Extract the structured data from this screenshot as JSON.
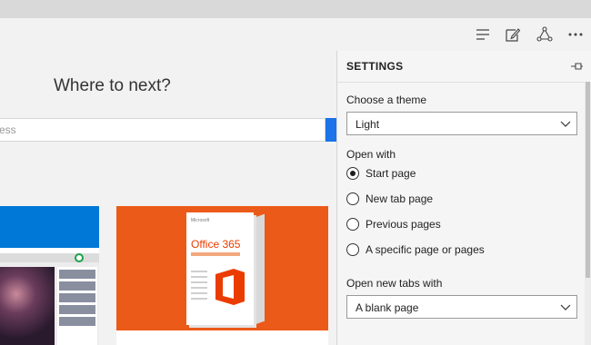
{
  "page": {
    "heading": "Where to next?",
    "search_placeholder": "ess"
  },
  "tiles": {
    "office_brand": "Microsoft",
    "office_title": "Office 365"
  },
  "toolbar": {
    "icons": [
      "hub-icon",
      "web-note-icon",
      "share-icon",
      "more-icon"
    ]
  },
  "settings": {
    "title": "SETTINGS",
    "theme_label": "Choose a theme",
    "theme_value": "Light",
    "open_with_label": "Open with",
    "open_with_options": [
      "Start page",
      "New tab page",
      "Previous pages",
      "A specific page or pages"
    ],
    "open_with_selected": 0,
    "new_tabs_label": "Open new tabs with",
    "new_tabs_value": "A blank page"
  },
  "colors": {
    "accent": "#0078d7",
    "office_orange": "#eb5a19"
  }
}
